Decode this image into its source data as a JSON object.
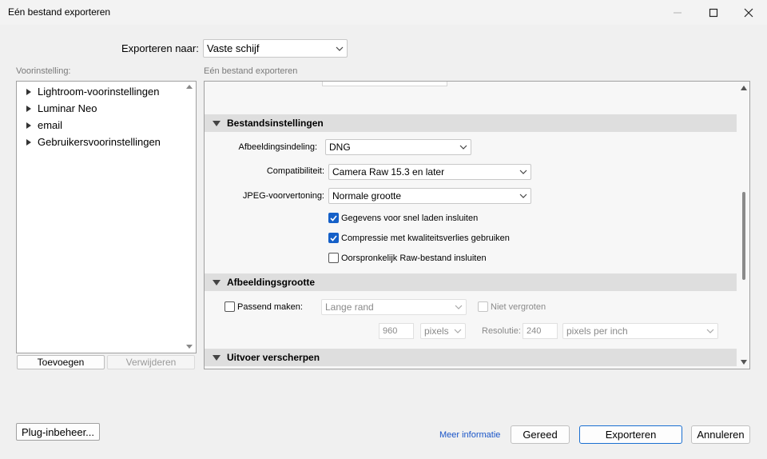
{
  "window": {
    "title": "Eén bestand exporteren",
    "minimize_icon": "minimize-icon",
    "maximize_icon": "maximize-icon",
    "close_icon": "close-icon"
  },
  "export_to": {
    "label": "Exporteren naar:",
    "value": "Vaste schijf"
  },
  "presets": {
    "label": "Voorinstelling:",
    "items": [
      {
        "label": "Lightroom-voorinstellingen"
      },
      {
        "label": "Luminar Neo"
      },
      {
        "label": "email"
      },
      {
        "label": "Gebruikersvoorinstellingen"
      }
    ],
    "add_label": "Toevoegen",
    "remove_label": "Verwijderen"
  },
  "right_panel": {
    "label": "Eén bestand exporteren",
    "file_settings": {
      "header": "Bestandsinstellingen",
      "format_label": "Afbeeldingsindeling:",
      "format_value": "DNG",
      "compat_label": "Compatibiliteit:",
      "compat_value": "Camera Raw 15.3 en later",
      "jpeg_label": "JPEG-voorvertoning:",
      "jpeg_value": "Normale grootte",
      "checkboxes": [
        {
          "label": "Gegevens voor snel laden insluiten",
          "checked": true
        },
        {
          "label": "Compressie met kwaliteitsverlies gebruiken",
          "checked": true
        },
        {
          "label": "Oorspronkelijk Raw-bestand insluiten",
          "checked": false
        }
      ]
    },
    "image_size": {
      "header": "Afbeeldingsgrootte",
      "fit_label": "Passend maken:",
      "fit_checked": false,
      "fit_value": "Lange rand",
      "no_enlarge_label": "Niet vergroten",
      "size_value": "960",
      "size_unit": "pixels",
      "resolution_label": "Resolutie:",
      "resolution_value": "240",
      "resolution_unit": "pixels per inch"
    },
    "sharpen": {
      "header": "Uitvoer verscherpen"
    }
  },
  "footer": {
    "plugin_label": "Plug-inbeheer...",
    "more_info": "Meer informatie",
    "done_label": "Gereed",
    "export_label": "Exporteren",
    "cancel_label": "Annuleren"
  },
  "colors": {
    "accent": "#1560c8",
    "link": "#1a55c8"
  }
}
